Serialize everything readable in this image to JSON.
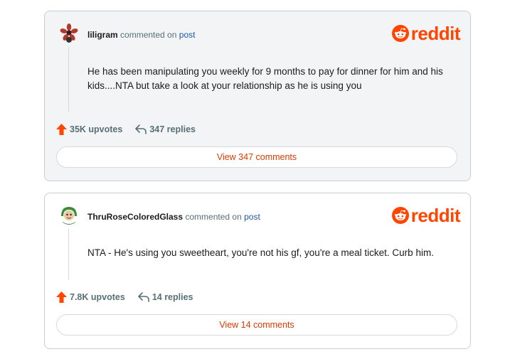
{
  "comments": [
    {
      "username": "liligram",
      "commented_on_text": "commented on",
      "post_link": "post",
      "body": "He has been manipulating you weekly for 9 months to pay for dinner for him and his kids....NTA but take a look at your relationship as he is using you",
      "upvotes": "35K upvotes",
      "replies": "347 replies",
      "view_button": "View 347 comments",
      "avatar_icon": "flower-avatar-icon"
    },
    {
      "username": "ThruRoseColoredGlass",
      "commented_on_text": "commented on",
      "post_link": "post",
      "body": "NTA - He's using you sweetheart, you're not his gf, you're a meal ticket. Curb him.",
      "upvotes": "7.8K upvotes",
      "replies": "14 replies",
      "view_button": "View 14 comments",
      "avatar_icon": "green-hood-avatar-icon"
    }
  ],
  "brand": {
    "wordmark": "reddit",
    "color": "#ff4500"
  },
  "colors": {
    "upvote": "#ff4500",
    "link": "#1f57a4",
    "view_button_text": "#d93a00"
  }
}
